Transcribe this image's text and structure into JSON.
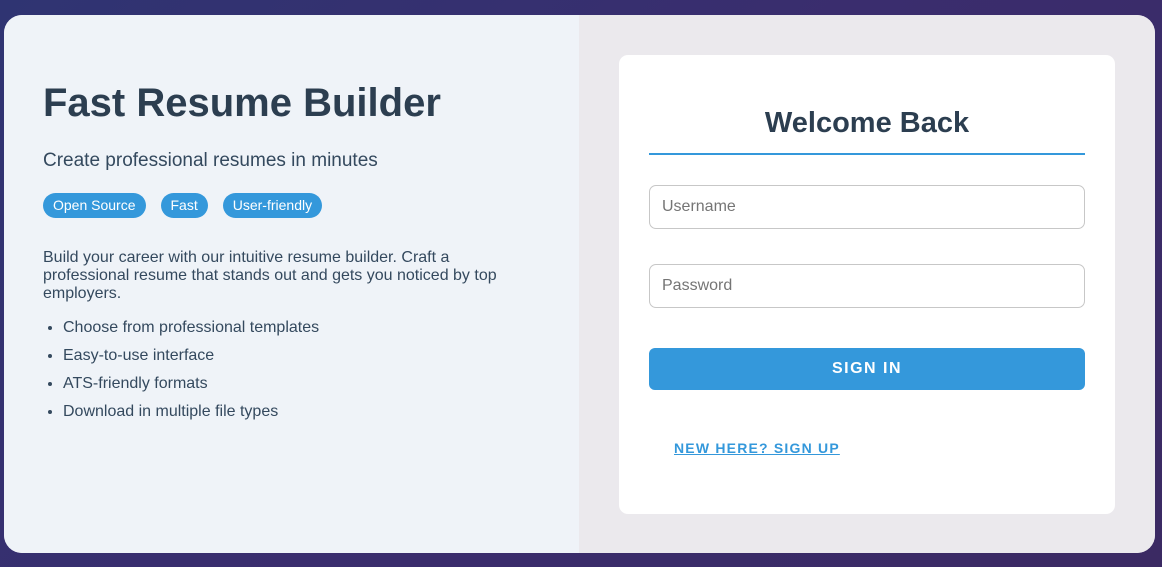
{
  "hero": {
    "title": "Fast Resume Builder",
    "subtitle": "Create professional resumes in minutes",
    "tags": [
      "Open Source",
      "Fast",
      "User-friendly"
    ],
    "description": "Build your career with our intuitive resume builder. Craft a professional resume that stands out and gets you noticed by top employers.",
    "features": [
      "Choose from professional templates",
      "Easy-to-use interface",
      "ATS-friendly formats",
      "Download in multiple file types"
    ]
  },
  "login": {
    "title": "Welcome Back",
    "username_placeholder": "Username",
    "password_placeholder": "Password",
    "signin_label": "SIGN IN",
    "signup_label": "NEW HERE? SIGN UP"
  },
  "colors": {
    "accent": "#3498db",
    "heading": "#2c3e50"
  }
}
